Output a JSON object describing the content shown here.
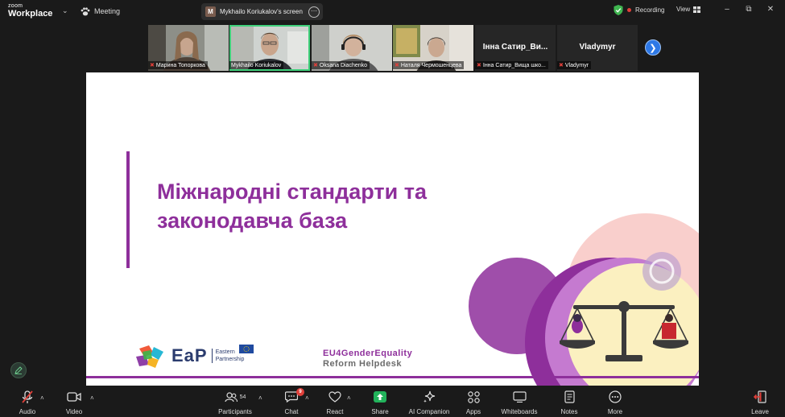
{
  "app": {
    "brand_line1": "zoom",
    "brand_line2": "Workplace",
    "meeting_label": "Meeting"
  },
  "screen_share": {
    "initial": "M",
    "label": "Mykhailo Koriukalov's screen"
  },
  "recording": {
    "label": "Recording"
  },
  "view": {
    "label": "View"
  },
  "participants": [
    {
      "name": "Марина Топоркова",
      "muted": true
    },
    {
      "name": "Mykhailo Koriukalov",
      "muted": false,
      "active": true
    },
    {
      "name": "Oksana Diachenko",
      "muted": true
    },
    {
      "name": "Наталя Чермошенцева",
      "muted": true
    },
    {
      "name": "Інна Сатир_Вища шко...",
      "display": "Інна Сатир_Ви...",
      "muted": true
    },
    {
      "name": "Vladymyr",
      "display": "Vladymyr",
      "muted": true
    }
  ],
  "slide": {
    "title_line1": "Міжнародні стандарти та",
    "title_line2": "законодавча база",
    "eap_word": "EaP",
    "eap_sub1": "Eastern",
    "eap_sub2": "Partnership",
    "eu4_line1": "EU4GenderEquality",
    "eu4_line2": "Reform Helpdesk",
    "accent_color": "#8e2f9b"
  },
  "toolbar": {
    "audio": "Audio",
    "video": "Video",
    "participants": "Participants",
    "participants_count": "54",
    "chat": "Chat",
    "chat_badge": "9",
    "react": "React",
    "share": "Share",
    "ai_companion": "AI Companion",
    "apps": "Apps",
    "whiteboards": "Whiteboards",
    "notes": "Notes",
    "more": "More",
    "leave": "Leave"
  }
}
